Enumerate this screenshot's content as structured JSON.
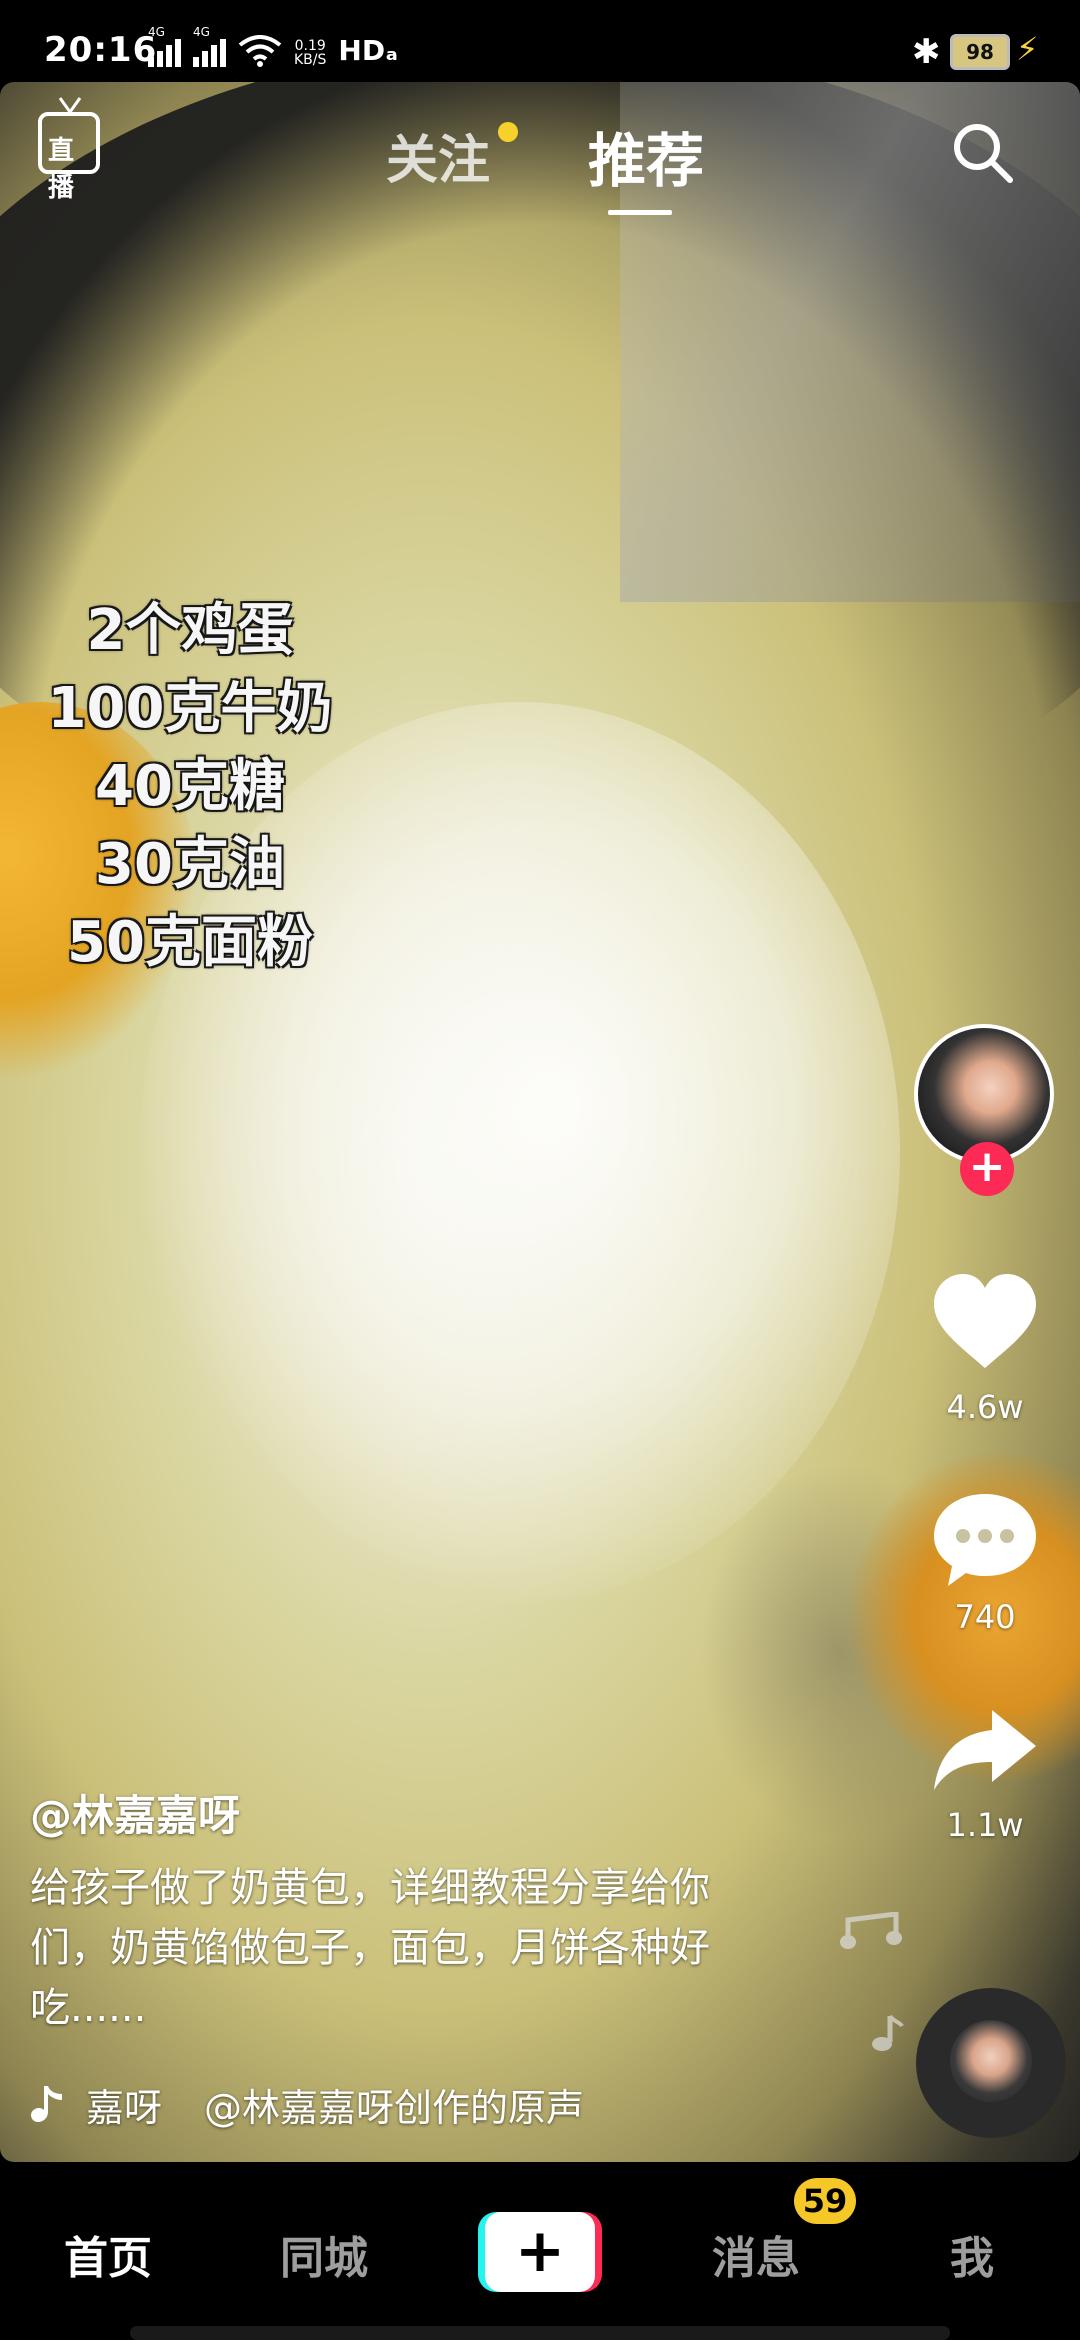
{
  "status_bar": {
    "time": "20:16",
    "net1": "4G",
    "net2": "4G",
    "speed_value": "0.19",
    "speed_unit": "KB/S",
    "hd": "HDₐ",
    "battery": "98"
  },
  "top_nav": {
    "live_label": "直播",
    "follow_tab": "关注",
    "recommend_tab": "推荐",
    "active_tab": "推荐"
  },
  "video": {
    "overlay_lines": [
      "2个鸡蛋",
      "100克牛奶",
      "40克糖",
      "30克油",
      "50克面粉"
    ]
  },
  "right_rail": {
    "likes": "4.6w",
    "comments": "740",
    "shares": "1.1w",
    "follow_symbol": "+"
  },
  "caption": {
    "author": "@林嘉嘉呀",
    "description": "给孩子做了奶黄包，详细教程分享给你们，奶黄馅做包子，面包，月饼各种好吃......",
    "music_title": "嘉呀",
    "music_original": "@林嘉嘉呀创作的原声"
  },
  "tab_bar": {
    "home": "首页",
    "nearby": "同城",
    "create": "+",
    "messages": "消息",
    "messages_badge": "59",
    "me": "我"
  },
  "colors": {
    "accent_red": "#fe2c55",
    "accent_cyan": "#25f4ee",
    "badge_yellow": "#f5c727",
    "follow_dot": "#f6d12c"
  }
}
